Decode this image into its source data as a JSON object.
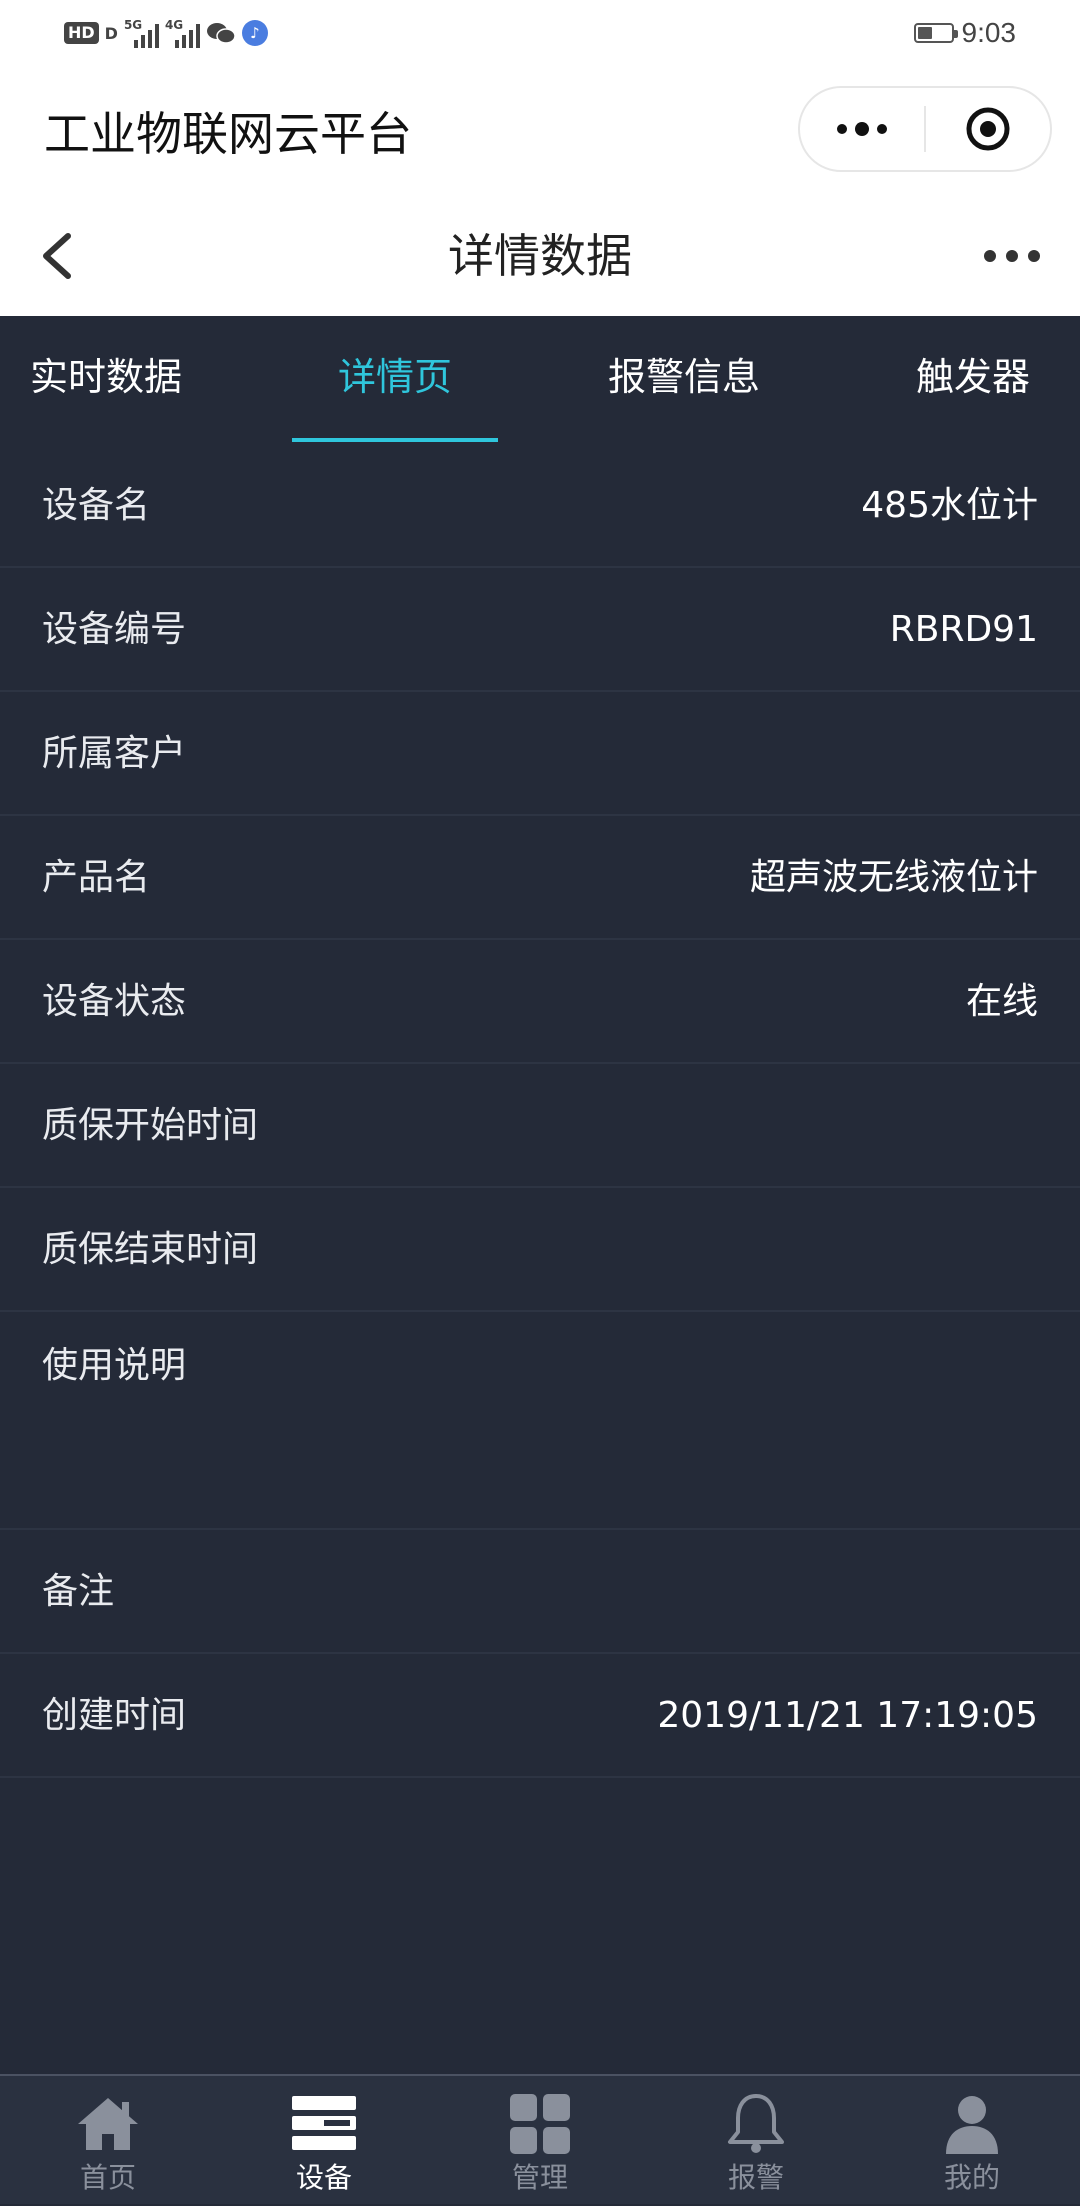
{
  "status_bar": {
    "hd": "HD",
    "hd_sub": "D",
    "sig1": "5G",
    "sig2": "4G",
    "time": "9:03",
    "battery_level": 0.45
  },
  "app": {
    "title": "工业物联网云平台"
  },
  "nav": {
    "title": "详情数据"
  },
  "tabs": [
    {
      "label": "实时数据",
      "active": false
    },
    {
      "label": "详情页",
      "active": true
    },
    {
      "label": "报警信息",
      "active": false
    },
    {
      "label": "触发器",
      "active": false
    }
  ],
  "details": [
    {
      "label": "设备名",
      "value": "485水位计"
    },
    {
      "label": "设备编号",
      "value": "RBRD91"
    },
    {
      "label": "所属客户",
      "value": ""
    },
    {
      "label": "产品名",
      "value": "超声波无线液位计"
    },
    {
      "label": "设备状态",
      "value": "在线"
    },
    {
      "label": "质保开始时间",
      "value": ""
    },
    {
      "label": "质保结束时间",
      "value": ""
    },
    {
      "label": "使用说明",
      "value": ""
    },
    {
      "label": "备注",
      "value": ""
    },
    {
      "label": "创建时间",
      "value": "2019/11/21 17:19:05"
    }
  ],
  "tabbar": [
    {
      "label": "首页",
      "icon": "home-icon",
      "active": false
    },
    {
      "label": "设备",
      "icon": "device-icon",
      "active": true
    },
    {
      "label": "管理",
      "icon": "grid-icon",
      "active": false
    },
    {
      "label": "报警",
      "icon": "bell-icon",
      "active": false
    },
    {
      "label": "我的",
      "icon": "user-icon",
      "active": false
    }
  ],
  "colors": {
    "accent": "#2fc6dc",
    "background": "#242a38",
    "tabbar": "#2a3140"
  }
}
